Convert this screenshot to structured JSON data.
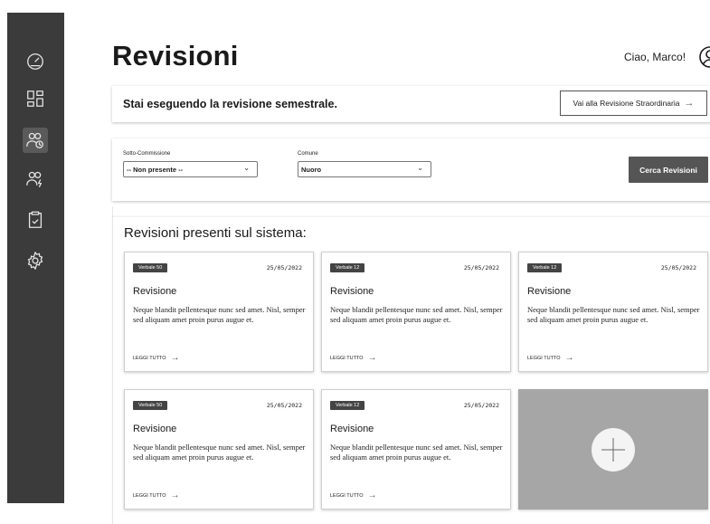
{
  "sidebar": {
    "icons": [
      "dashboard-gauge-icon",
      "layout-grid-icon",
      "users-clock-icon",
      "users-bolt-icon",
      "clipboard-check-icon",
      "settings-gear-icon"
    ]
  },
  "header": {
    "title": "Revisioni",
    "greeting": "Ciao, Marco!"
  },
  "banner": {
    "text": "Stai eseguendo la revisione semestrale.",
    "button_label": "Vai alla Revisione Straordinaria",
    "button_arrow": "→"
  },
  "filters": {
    "sotto_commissione": {
      "label": "Sotto-Commissione",
      "value": "-- Non presente --"
    },
    "comune": {
      "label": "Comune",
      "value": "Nuoro"
    },
    "search_button": "Cerca Revisioni"
  },
  "section": {
    "title": "Revisioni presenti sul sistema:"
  },
  "cards": [
    {
      "badge": "Verbale 50",
      "date": "25/05/2022",
      "title": "Revisione",
      "body": "Neque blandit pellentesque nunc sed amet. Nisl, semper sed aliquam amet proin purus augue et.",
      "link": "LEGGI TUTTO"
    },
    {
      "badge": "Verbale 12",
      "date": "25/05/2022",
      "title": "Revisione",
      "body": "Neque blandit pellentesque nunc sed amet. Nisl, semper sed aliquam amet proin purus augue et.",
      "link": "LEGGI TUTTO"
    },
    {
      "badge": "Verbale 12",
      "date": "25/05/2022",
      "title": "Revisione",
      "body": "Neque blandit pellentesque nunc sed amet. Nisl, semper sed aliquam amet proin purus augue et.",
      "link": "LEGGI TUTTO"
    },
    {
      "badge": "Verbale 50",
      "date": "25/05/2022",
      "title": "Revisione",
      "body": "Neque blandit pellentesque nunc sed amet. Nisl, semper sed aliquam amet proin purus augue et.",
      "link": "LEGGI TUTTO"
    },
    {
      "badge": "Verbale 12",
      "date": "25/05/2022",
      "title": "Revisione",
      "body": "Neque blandit pellentesque nunc sed amet. Nisl, semper sed aliquam amet proin purus augue et.",
      "link": "LEGGI TUTTO"
    }
  ],
  "add_card": {
    "icon": "plus-icon"
  },
  "colors": {
    "sidebar_bg": "#3b3b3b",
    "dark_button": "#555555",
    "add_card_bg": "#a6a6a6"
  }
}
